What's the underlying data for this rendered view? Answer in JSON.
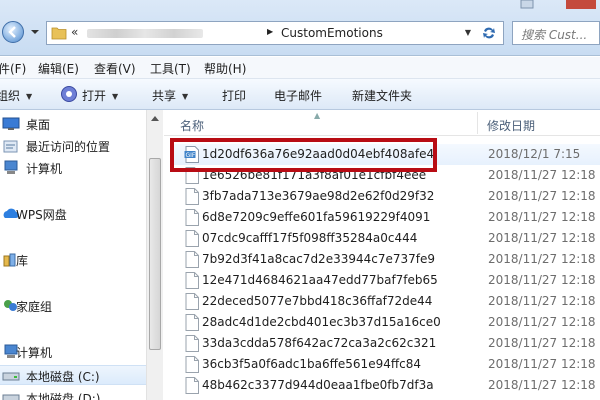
{
  "address": {
    "path_current": "CustomEmotions",
    "separator": "«",
    "search_placeholder": "搜索 Cust..."
  },
  "menu": {
    "items": [
      "件(F)",
      "编辑(E)",
      "查看(V)",
      "工具(T)",
      "帮助(H)"
    ]
  },
  "toolbar": {
    "organize": "组织",
    "open": "打开",
    "share": "共享",
    "print": "打印",
    "email": "电子邮件",
    "new_folder": "新建文件夹"
  },
  "nav": {
    "items": [
      {
        "label": "桌面",
        "icon": "desktop-icon"
      },
      {
        "label": "最近访问的位置",
        "icon": "recent-places-icon"
      },
      {
        "label": "计算机",
        "icon": "computer-icon"
      },
      {
        "label": "WPS网盘",
        "icon": "wps-cloud-icon"
      },
      {
        "label": "库",
        "icon": "library-icon"
      },
      {
        "label": "家庭组",
        "icon": "homegroup-icon"
      },
      {
        "label": "计算机",
        "icon": "computer-icon"
      },
      {
        "label": "本地磁盘 (C:)",
        "icon": "drive-icon"
      },
      {
        "label": "本地磁盘 (D:)",
        "icon": "drive-icon"
      }
    ]
  },
  "columns": {
    "name": "名称",
    "date": "修改日期"
  },
  "files": [
    {
      "name": "1d20df636a76e92aad0d04ebf408afe4",
      "date": "2018/12/1 7:15",
      "type": "gif"
    },
    {
      "name": "1e6526be81f171a3f8af01e1cfbf4eee",
      "date": "2018/11/27 12:18",
      "type": "file"
    },
    {
      "name": "3fb7ada713e3679ae98d2e62f0d29f32",
      "date": "2018/11/27 12:18",
      "type": "file"
    },
    {
      "name": "6d8e7209c9effe601fa59619229f4091",
      "date": "2018/11/27 12:18",
      "type": "file"
    },
    {
      "name": "07cdc9cafff17f5f098ff35284a0c444",
      "date": "2018/11/27 12:18",
      "type": "file"
    },
    {
      "name": "7b92d3f41a8cac7d2e33944c7e737fe9",
      "date": "2018/11/27 12:18",
      "type": "file"
    },
    {
      "name": "12e471d4684621aa47edd77baf7feb65",
      "date": "2018/11/27 12:18",
      "type": "file"
    },
    {
      "name": "22deced5077e7bbd418c36ffaf72de44",
      "date": "2018/11/27 12:18",
      "type": "file"
    },
    {
      "name": "28adc4d1de2cbd401ec3b37d15a16ce0",
      "date": "2018/11/27 12:18",
      "type": "file"
    },
    {
      "name": "33da3cdda578f642ac72ca3a2c62c321",
      "date": "2018/11/27 12:18",
      "type": "file"
    },
    {
      "name": "36cb3f5a0f6adc1ba6ffe561e94ffc84",
      "date": "2018/11/27 12:18",
      "type": "file"
    },
    {
      "name": "48b462c3377d944d0eaa1fbe0fb7df3a",
      "date": "2018/11/27 12:18",
      "type": "file"
    }
  ],
  "annotation": {
    "color": "#b80c14"
  }
}
